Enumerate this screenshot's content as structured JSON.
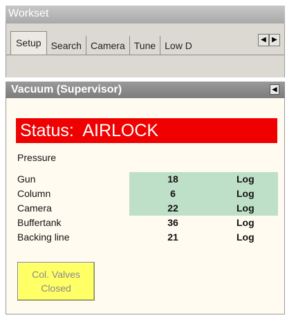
{
  "workset": {
    "title": "Workset"
  },
  "tabs": [
    {
      "label": "Setup",
      "active": true
    },
    {
      "label": "Search",
      "active": false
    },
    {
      "label": "Camera",
      "active": false
    },
    {
      "label": "Tune",
      "active": false
    },
    {
      "label": "Low D",
      "active": false
    }
  ],
  "tab_scroll": {
    "left_glyph": "◀",
    "right_glyph": "▶"
  },
  "panel": {
    "title": "Vacuum (Supervisor)",
    "collapse_glyph": "◀",
    "status_text": "Status:  AIRLOCK",
    "status_color": "#f00000",
    "pressure_label": "Pressure",
    "highlight_color": "#bfe0c8",
    "rows": [
      {
        "name": "Gun",
        "value": "18",
        "log": "Log",
        "highlighted": true
      },
      {
        "name": "Column",
        "value": "6",
        "log": "Log",
        "highlighted": true
      },
      {
        "name": "Camera",
        "value": "22",
        "log": "Log",
        "highlighted": true
      },
      {
        "name": "Buffertank",
        "value": "36",
        "log": "Log",
        "highlighted": false
      },
      {
        "name": "Backing line",
        "value": "21",
        "log": "Log",
        "highlighted": false
      }
    ],
    "valves_button": {
      "line1": "Col. Valves",
      "line2": "Closed",
      "color": "#ffff66"
    }
  }
}
